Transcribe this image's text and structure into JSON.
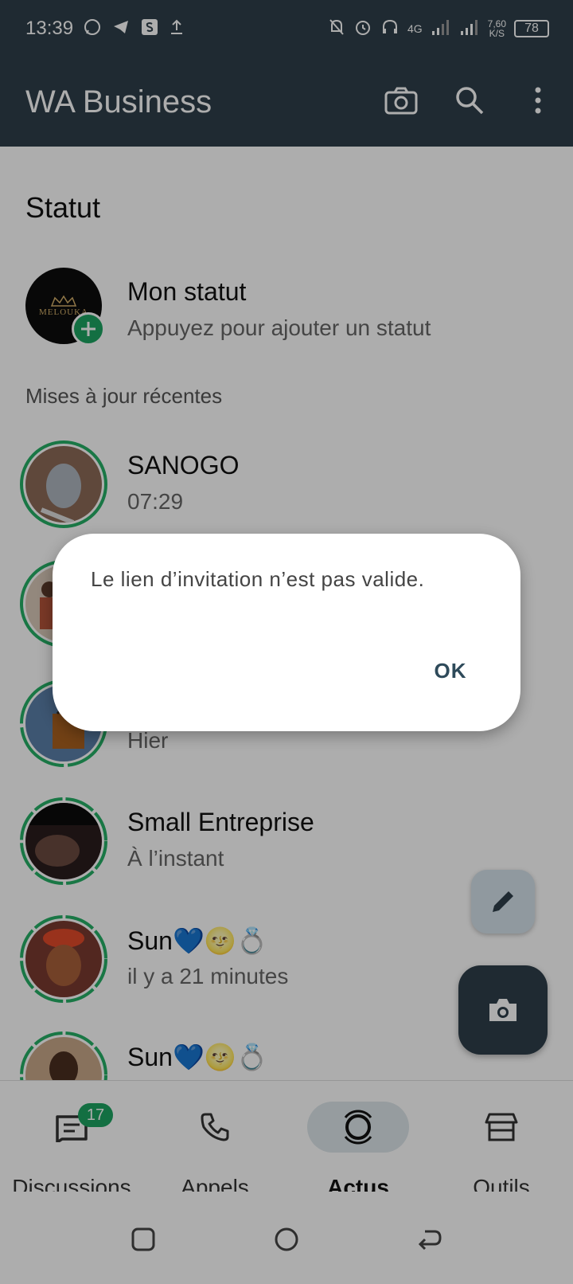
{
  "status_bar": {
    "time": "13:39",
    "network": "4G",
    "speed_value": "7,60",
    "speed_unit": "K/S",
    "battery": "78"
  },
  "app_bar": {
    "title": "WA Business",
    "icons": [
      "camera-icon",
      "search-icon",
      "more-vert-icon"
    ]
  },
  "content": {
    "section_title": "Statut",
    "my_status": {
      "name": "Mon statut",
      "subtitle": "Appuyez pour ajouter un statut",
      "logo_text": "MELOUKA"
    },
    "recent_label": "Mises à jour récentes",
    "statuses": [
      {
        "name": "SANOGO",
        "time": "07:29",
        "thumb_color": "#8c6a58"
      },
      {
        "name": "",
        "time": "",
        "thumb_color": "#d9c9b8"
      },
      {
        "name": "",
        "time": "Hier",
        "thumb_color": "#5b7fa8"
      },
      {
        "name": "Small Entreprise",
        "time": "À l’instant",
        "thumb_color": "#2a1c1c"
      },
      {
        "name": "Sun💙🌝💍",
        "time": "il y a 21 minutes",
        "thumb_color": "#7a3a30"
      },
      {
        "name": "Sun💙🌝💍",
        "time": "",
        "thumb_color": "#c9a98a"
      }
    ]
  },
  "fabs": {
    "edit_icon": "pencil-icon",
    "camera_icon": "camera-icon"
  },
  "bottom_nav": {
    "items": [
      {
        "label": "Discussions",
        "icon": "chat-icon",
        "badge": "17",
        "active": false
      },
      {
        "label": "Appels",
        "icon": "phone-icon",
        "active": false
      },
      {
        "label": "Actus",
        "icon": "updates-icon",
        "active": true
      },
      {
        "label": "Outils",
        "icon": "store-icon",
        "active": false
      }
    ]
  },
  "dialog": {
    "message": "Le lien d’invitation n’est pas valide.",
    "ok_label": "OK"
  },
  "colors": {
    "app_bar": "#2e3f4a",
    "accent_green": "#1da462",
    "active_nav_bg": "#dde6ea"
  }
}
